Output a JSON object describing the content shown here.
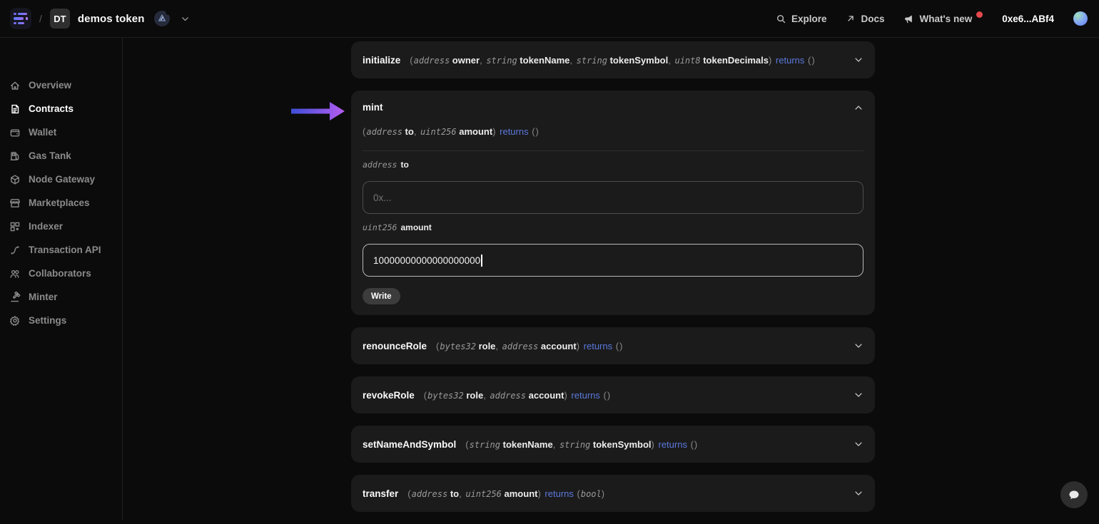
{
  "topbar": {
    "logo_icon": "app-logo-icon",
    "breadcrumb_separator": "/",
    "project_badge": "DT",
    "project_name": "demos token",
    "chain_badge_icon": "chain-badge-icon",
    "chain_dot_color": "#f2a33c",
    "nav_items": [
      {
        "label": "Explore",
        "icon": "search-icon",
        "notification": false
      },
      {
        "label": "Docs",
        "icon": "arrow-up-right-icon",
        "notification": false
      },
      {
        "label": "What's new",
        "icon": "megaphone-icon",
        "notification": true
      }
    ],
    "notification_color": "#e5484d",
    "account_address": "0xe6...ABf4"
  },
  "sidebar": {
    "items": [
      {
        "label": "Overview",
        "icon": "home-icon",
        "active": false
      },
      {
        "label": "Contracts",
        "icon": "contract-file-icon",
        "active": true
      },
      {
        "label": "Wallet",
        "icon": "wallet-icon",
        "active": false
      },
      {
        "label": "Gas Tank",
        "icon": "gas-pump-icon",
        "active": false
      },
      {
        "label": "Node Gateway",
        "icon": "cube-icon",
        "active": false
      },
      {
        "label": "Marketplaces",
        "icon": "storefront-icon",
        "active": false
      },
      {
        "label": "Indexer",
        "icon": "grid-blocks-icon",
        "active": false
      },
      {
        "label": "Transaction API",
        "icon": "path-curve-icon",
        "active": false
      },
      {
        "label": "Collaborators",
        "icon": "people-icon",
        "active": false
      },
      {
        "label": "Minter",
        "icon": "gavel-icon",
        "active": false
      },
      {
        "label": "Settings",
        "icon": "gear-icon",
        "active": false
      }
    ]
  },
  "functions": [
    {
      "name": "initialize",
      "expanded": false,
      "signature": [
        [
          "p",
          "("
        ],
        [
          "t",
          "address"
        ],
        [
          "n",
          " owner"
        ],
        [
          "p",
          ", "
        ],
        [
          "t",
          "string"
        ],
        [
          "n",
          " tokenName"
        ],
        [
          "p",
          ", "
        ],
        [
          "t",
          "string"
        ],
        [
          "n",
          " tokenSymbol"
        ],
        [
          "p",
          ", "
        ],
        [
          "t",
          "uint8"
        ],
        [
          "n",
          " tokenDecimals"
        ],
        [
          "p",
          ") "
        ],
        [
          "r",
          "returns"
        ],
        [
          "p",
          " ()"
        ]
      ]
    },
    {
      "name": "mint",
      "expanded": true,
      "signature": [
        [
          "p",
          "("
        ],
        [
          "t",
          "address"
        ],
        [
          "n",
          " to"
        ],
        [
          "p",
          ", "
        ],
        [
          "t",
          "uint256"
        ],
        [
          "n",
          " amount"
        ],
        [
          "p",
          ") "
        ],
        [
          "r",
          "returns"
        ],
        [
          "p",
          " ()"
        ]
      ],
      "fields": [
        {
          "type": "address",
          "name": "to",
          "placeholder": "0x...",
          "value": "",
          "focused": false
        },
        {
          "type": "uint256",
          "name": "amount",
          "placeholder": "",
          "value": "10000000000000000000",
          "focused": true
        }
      ],
      "write_label": "Write"
    },
    {
      "name": "renounceRole",
      "expanded": false,
      "signature": [
        [
          "p",
          "("
        ],
        [
          "t",
          "bytes32"
        ],
        [
          "n",
          " role"
        ],
        [
          "p",
          ", "
        ],
        [
          "t",
          "address"
        ],
        [
          "n",
          " account"
        ],
        [
          "p",
          ") "
        ],
        [
          "r",
          "returns"
        ],
        [
          "p",
          " ()"
        ]
      ]
    },
    {
      "name": "revokeRole",
      "expanded": false,
      "signature": [
        [
          "p",
          "("
        ],
        [
          "t",
          "bytes32"
        ],
        [
          "n",
          " role"
        ],
        [
          "p",
          ", "
        ],
        [
          "t",
          "address"
        ],
        [
          "n",
          " account"
        ],
        [
          "p",
          ") "
        ],
        [
          "r",
          "returns"
        ],
        [
          "p",
          " ()"
        ]
      ]
    },
    {
      "name": "setNameAndSymbol",
      "expanded": false,
      "signature": [
        [
          "p",
          "("
        ],
        [
          "t",
          "string"
        ],
        [
          "n",
          " tokenName"
        ],
        [
          "p",
          ", "
        ],
        [
          "t",
          "string"
        ],
        [
          "n",
          " tokenSymbol"
        ],
        [
          "p",
          ") "
        ],
        [
          "r",
          "returns"
        ],
        [
          "p",
          " ()"
        ]
      ]
    },
    {
      "name": "transfer",
      "expanded": false,
      "signature": [
        [
          "p",
          "("
        ],
        [
          "t",
          "address"
        ],
        [
          "n",
          " to"
        ],
        [
          "p",
          ", "
        ],
        [
          "t",
          "uint256"
        ],
        [
          "n",
          " amount"
        ],
        [
          "p",
          ") "
        ],
        [
          "r",
          "returns"
        ],
        [
          "p",
          " ("
        ],
        [
          "t",
          "bool"
        ],
        [
          "p",
          ")"
        ]
      ]
    }
  ],
  "annotation": {
    "arrow_color_from": "#3d4fd7",
    "arrow_color_to": "#b55cf0",
    "points_to": "mint"
  },
  "chat_button": {
    "icon": "chat-bubble-icon"
  },
  "colors": {
    "accent_blue": "#5b78dd",
    "panel_bg": "#1b1b1b",
    "page_bg": "#0b0b0b"
  }
}
